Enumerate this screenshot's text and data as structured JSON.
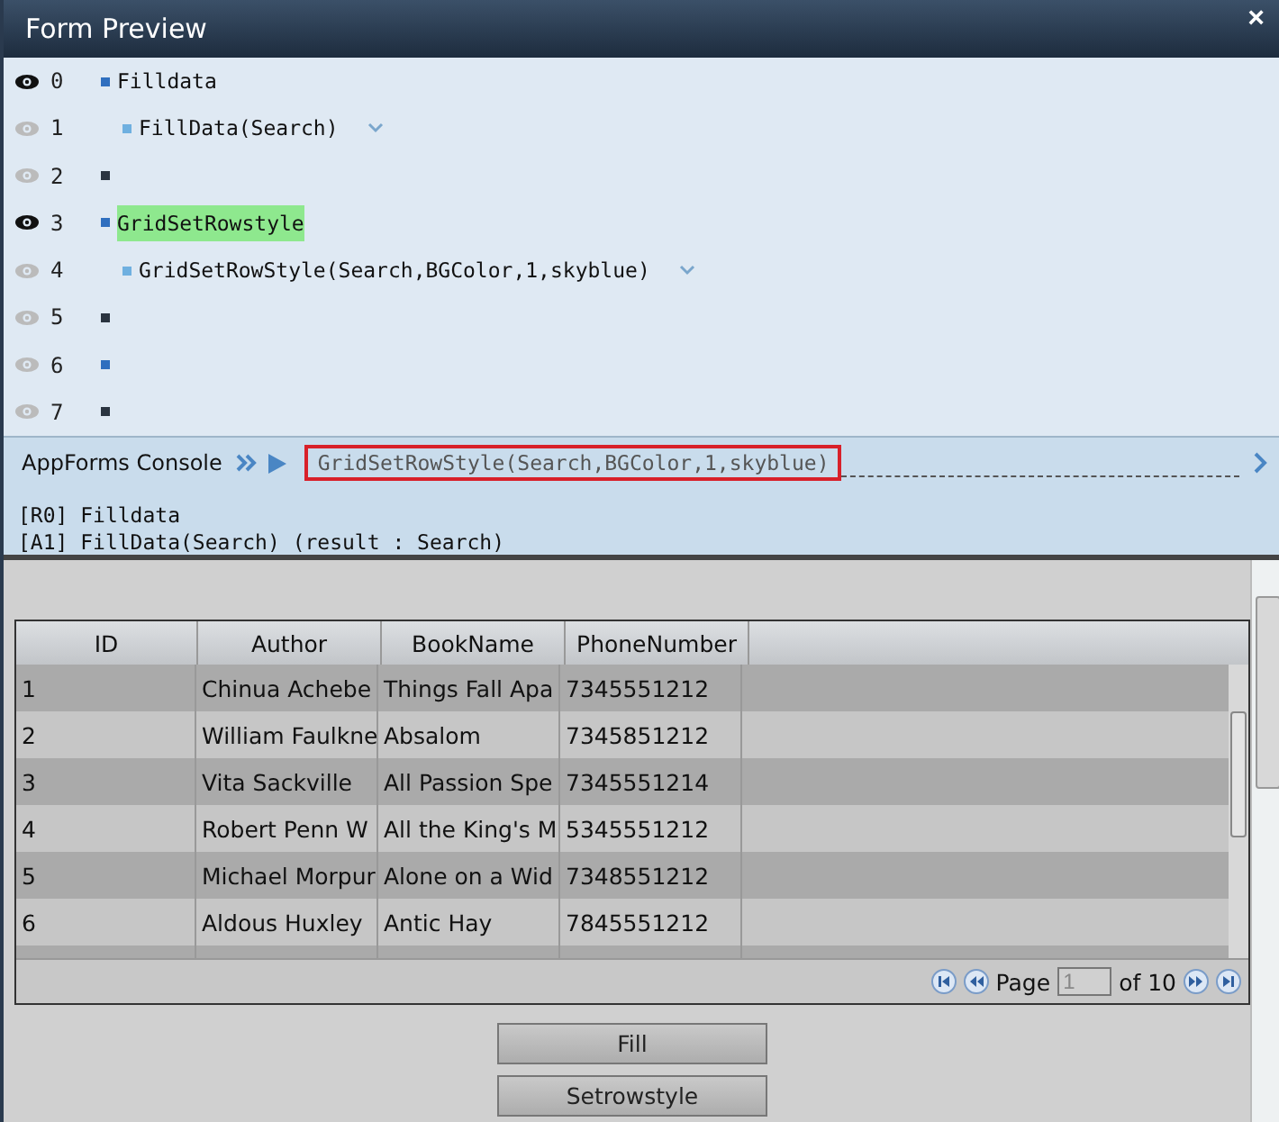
{
  "window": {
    "title": "Form Preview",
    "close": "×"
  },
  "lines": [
    {
      "number": "0",
      "visible": true,
      "color": "#2f6fbf",
      "text": "Filldata",
      "highlighted": false,
      "children": [
        {
          "number": "1",
          "visible": false,
          "color": "#6fb0e0",
          "text": "FillData(Search)",
          "highlighted": false,
          "menu": true
        }
      ]
    },
    {
      "number": "2",
      "visible": false,
      "color": "#2a3440"
    },
    {
      "number": "3",
      "visible": true,
      "color": "#2f6fbf",
      "text": "GridSetRowstyle",
      "highlighted": true,
      "children": [
        {
          "number": "4",
          "visible": false,
          "color": "#6fb0e0",
          "text": "GridSetRowStyle(Search,BGColor,1,skyblue)",
          "highlighted": false,
          "menu": true
        }
      ]
    },
    {
      "number": "5",
      "visible": false,
      "color": "#2a3440"
    },
    {
      "number": "6",
      "visible": false,
      "color": "#2f6fbf"
    },
    {
      "number": "7",
      "visible": false,
      "color": "#2a3440"
    }
  ],
  "console": {
    "label": "AppForms Console",
    "command": "GridSetRowStyle(Search,BGColor,1,skyblue)",
    "output": [
      "[R0] Filldata",
      "[A1] FillData(Search) (result : Search)"
    ]
  },
  "table": {
    "columns": [
      "ID",
      "Author",
      "BookName",
      "PhoneNumber"
    ],
    "rows": [
      [
        "1",
        "Chinua Achebe",
        "Things Fall Apa",
        "7345551212"
      ],
      [
        "2",
        "William Faulkne",
        "Absalom",
        "7345851212"
      ],
      [
        "3",
        "Vita Sackville",
        "All Passion Spe",
        "7345551214"
      ],
      [
        "4",
        "Robert Penn W",
        "All the King's M",
        "5345551212"
      ],
      [
        "5",
        "Michael Morpur",
        "Alone on a Wid",
        "7348551212"
      ],
      [
        "6",
        "Aldous Huxley",
        "Antic Hay",
        "7845551212"
      ]
    ]
  },
  "pager": {
    "label": "Page",
    "page": "1",
    "of": "of 10"
  },
  "buttons": [
    "Fill",
    "Setrowstyle"
  ]
}
